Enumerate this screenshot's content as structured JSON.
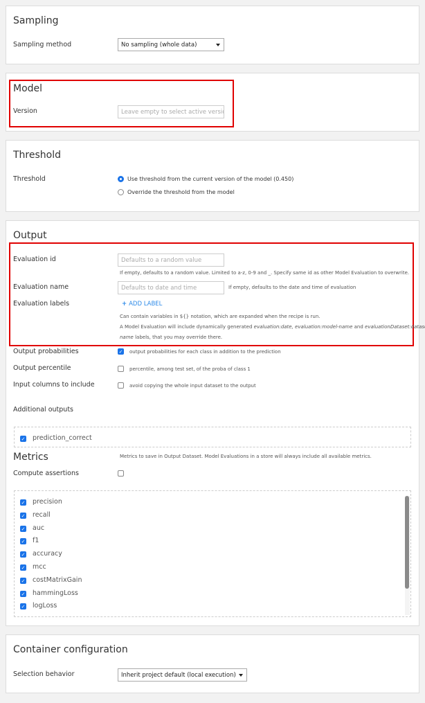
{
  "sampling": {
    "title": "Sampling",
    "method_label": "Sampling method",
    "method_value": "No sampling (whole data)"
  },
  "model": {
    "title": "Model",
    "version_label": "Version",
    "version_placeholder": "Leave empty to select active version"
  },
  "threshold": {
    "title": "Threshold",
    "label": "Threshold",
    "options": [
      {
        "label": "Use threshold from the current version of the model (0.450)",
        "selected": true
      },
      {
        "label": "Override the threshold from the model",
        "selected": false
      }
    ]
  },
  "output": {
    "title": "Output",
    "eval_id_label": "Evaluation id",
    "eval_id_placeholder": "Defaults to a random value",
    "eval_id_help": "If empty, defaults to a random value. Limited to a-z, 0-9 and _. Specify same id as other Model Evaluation to overwrite.",
    "eval_name_label": "Evaluation name",
    "eval_name_placeholder": "Defaults to date and time",
    "eval_name_help": "If empty, defaults to the date and time of evaluation",
    "eval_labels_label": "Evaluation labels",
    "add_label": "ADD LABEL",
    "labels_help1": "Can contain variables in ${} notation, which are expanded when the recipe is run.",
    "labels_help2_a": "A Model Evaluation will include dynamically generated ",
    "labels_help2_b": "evaluation:date, evaluation:model-name",
    "labels_help2_c": " and ",
    "labels_help2_d": "evaluationDataset:dataset-",
    "labels_help3_a": "name",
    "labels_help3_b": " labels, that you may override there.",
    "out_prob_label": "Output probabilities",
    "out_prob_help": "output probabilities for each class in addition to the prediction",
    "out_prob_checked": true,
    "out_pct_label": "Output percentile",
    "out_pct_help": "percentile, among test set, of the proba of class 1",
    "out_pct_checked": false,
    "input_cols_label": "Input columns to include",
    "input_cols_help": "avoid copying the whole input dataset to the output",
    "input_cols_checked": false,
    "additional_label": "Additional outputs",
    "additional_items": [
      {
        "label": "prediction_correct",
        "checked": true
      }
    ]
  },
  "metrics": {
    "title": "Metrics",
    "note": "Metrics to save in Output Dataset. Model Evaluations in a store will always include all available metrics.",
    "assert_label": "Compute assertions",
    "assert_checked": false,
    "items": [
      {
        "label": "precision",
        "checked": true
      },
      {
        "label": "recall",
        "checked": true
      },
      {
        "label": "auc",
        "checked": true
      },
      {
        "label": "f1",
        "checked": true
      },
      {
        "label": "accuracy",
        "checked": true
      },
      {
        "label": "mcc",
        "checked": true
      },
      {
        "label": "costMatrixGain",
        "checked": true
      },
      {
        "label": "hammingLoss",
        "checked": true
      },
      {
        "label": "logLoss",
        "checked": true
      }
    ]
  },
  "container": {
    "title": "Container configuration",
    "label": "Selection behavior",
    "value": "Inherit project default (local execution)"
  },
  "colors": {
    "accent": "#1a73e8",
    "highlight": "#e00000"
  }
}
